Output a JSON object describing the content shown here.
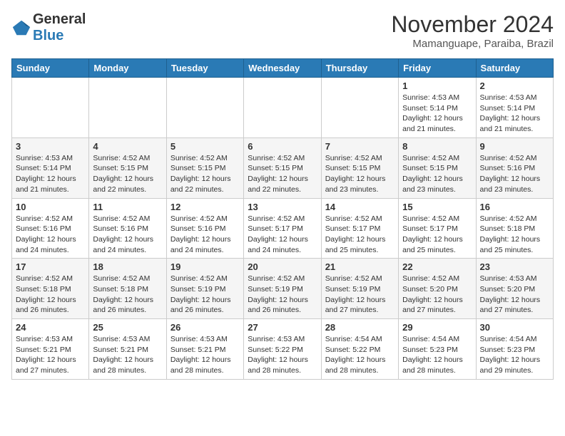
{
  "header": {
    "title": "November 2024",
    "subtitle": "Mamanguape, Paraiba, Brazil",
    "logo_general": "General",
    "logo_blue": "Blue"
  },
  "weekdays": [
    "Sunday",
    "Monday",
    "Tuesday",
    "Wednesday",
    "Thursday",
    "Friday",
    "Saturday"
  ],
  "weeks": [
    [
      {
        "day": "",
        "info": ""
      },
      {
        "day": "",
        "info": ""
      },
      {
        "day": "",
        "info": ""
      },
      {
        "day": "",
        "info": ""
      },
      {
        "day": "",
        "info": ""
      },
      {
        "day": "1",
        "info": "Sunrise: 4:53 AM\nSunset: 5:14 PM\nDaylight: 12 hours\nand 21 minutes."
      },
      {
        "day": "2",
        "info": "Sunrise: 4:53 AM\nSunset: 5:14 PM\nDaylight: 12 hours\nand 21 minutes."
      }
    ],
    [
      {
        "day": "3",
        "info": "Sunrise: 4:53 AM\nSunset: 5:14 PM\nDaylight: 12 hours\nand 21 minutes."
      },
      {
        "day": "4",
        "info": "Sunrise: 4:52 AM\nSunset: 5:15 PM\nDaylight: 12 hours\nand 22 minutes."
      },
      {
        "day": "5",
        "info": "Sunrise: 4:52 AM\nSunset: 5:15 PM\nDaylight: 12 hours\nand 22 minutes."
      },
      {
        "day": "6",
        "info": "Sunrise: 4:52 AM\nSunset: 5:15 PM\nDaylight: 12 hours\nand 22 minutes."
      },
      {
        "day": "7",
        "info": "Sunrise: 4:52 AM\nSunset: 5:15 PM\nDaylight: 12 hours\nand 23 minutes."
      },
      {
        "day": "8",
        "info": "Sunrise: 4:52 AM\nSunset: 5:15 PM\nDaylight: 12 hours\nand 23 minutes."
      },
      {
        "day": "9",
        "info": "Sunrise: 4:52 AM\nSunset: 5:16 PM\nDaylight: 12 hours\nand 23 minutes."
      }
    ],
    [
      {
        "day": "10",
        "info": "Sunrise: 4:52 AM\nSunset: 5:16 PM\nDaylight: 12 hours\nand 24 minutes."
      },
      {
        "day": "11",
        "info": "Sunrise: 4:52 AM\nSunset: 5:16 PM\nDaylight: 12 hours\nand 24 minutes."
      },
      {
        "day": "12",
        "info": "Sunrise: 4:52 AM\nSunset: 5:16 PM\nDaylight: 12 hours\nand 24 minutes."
      },
      {
        "day": "13",
        "info": "Sunrise: 4:52 AM\nSunset: 5:17 PM\nDaylight: 12 hours\nand 24 minutes."
      },
      {
        "day": "14",
        "info": "Sunrise: 4:52 AM\nSunset: 5:17 PM\nDaylight: 12 hours\nand 25 minutes."
      },
      {
        "day": "15",
        "info": "Sunrise: 4:52 AM\nSunset: 5:17 PM\nDaylight: 12 hours\nand 25 minutes."
      },
      {
        "day": "16",
        "info": "Sunrise: 4:52 AM\nSunset: 5:18 PM\nDaylight: 12 hours\nand 25 minutes."
      }
    ],
    [
      {
        "day": "17",
        "info": "Sunrise: 4:52 AM\nSunset: 5:18 PM\nDaylight: 12 hours\nand 26 minutes."
      },
      {
        "day": "18",
        "info": "Sunrise: 4:52 AM\nSunset: 5:18 PM\nDaylight: 12 hours\nand 26 minutes."
      },
      {
        "day": "19",
        "info": "Sunrise: 4:52 AM\nSunset: 5:19 PM\nDaylight: 12 hours\nand 26 minutes."
      },
      {
        "day": "20",
        "info": "Sunrise: 4:52 AM\nSunset: 5:19 PM\nDaylight: 12 hours\nand 26 minutes."
      },
      {
        "day": "21",
        "info": "Sunrise: 4:52 AM\nSunset: 5:19 PM\nDaylight: 12 hours\nand 27 minutes."
      },
      {
        "day": "22",
        "info": "Sunrise: 4:52 AM\nSunset: 5:20 PM\nDaylight: 12 hours\nand 27 minutes."
      },
      {
        "day": "23",
        "info": "Sunrise: 4:53 AM\nSunset: 5:20 PM\nDaylight: 12 hours\nand 27 minutes."
      }
    ],
    [
      {
        "day": "24",
        "info": "Sunrise: 4:53 AM\nSunset: 5:21 PM\nDaylight: 12 hours\nand 27 minutes."
      },
      {
        "day": "25",
        "info": "Sunrise: 4:53 AM\nSunset: 5:21 PM\nDaylight: 12 hours\nand 28 minutes."
      },
      {
        "day": "26",
        "info": "Sunrise: 4:53 AM\nSunset: 5:21 PM\nDaylight: 12 hours\nand 28 minutes."
      },
      {
        "day": "27",
        "info": "Sunrise: 4:53 AM\nSunset: 5:22 PM\nDaylight: 12 hours\nand 28 minutes."
      },
      {
        "day": "28",
        "info": "Sunrise: 4:54 AM\nSunset: 5:22 PM\nDaylight: 12 hours\nand 28 minutes."
      },
      {
        "day": "29",
        "info": "Sunrise: 4:54 AM\nSunset: 5:23 PM\nDaylight: 12 hours\nand 28 minutes."
      },
      {
        "day": "30",
        "info": "Sunrise: 4:54 AM\nSunset: 5:23 PM\nDaylight: 12 hours\nand 29 minutes."
      }
    ]
  ]
}
